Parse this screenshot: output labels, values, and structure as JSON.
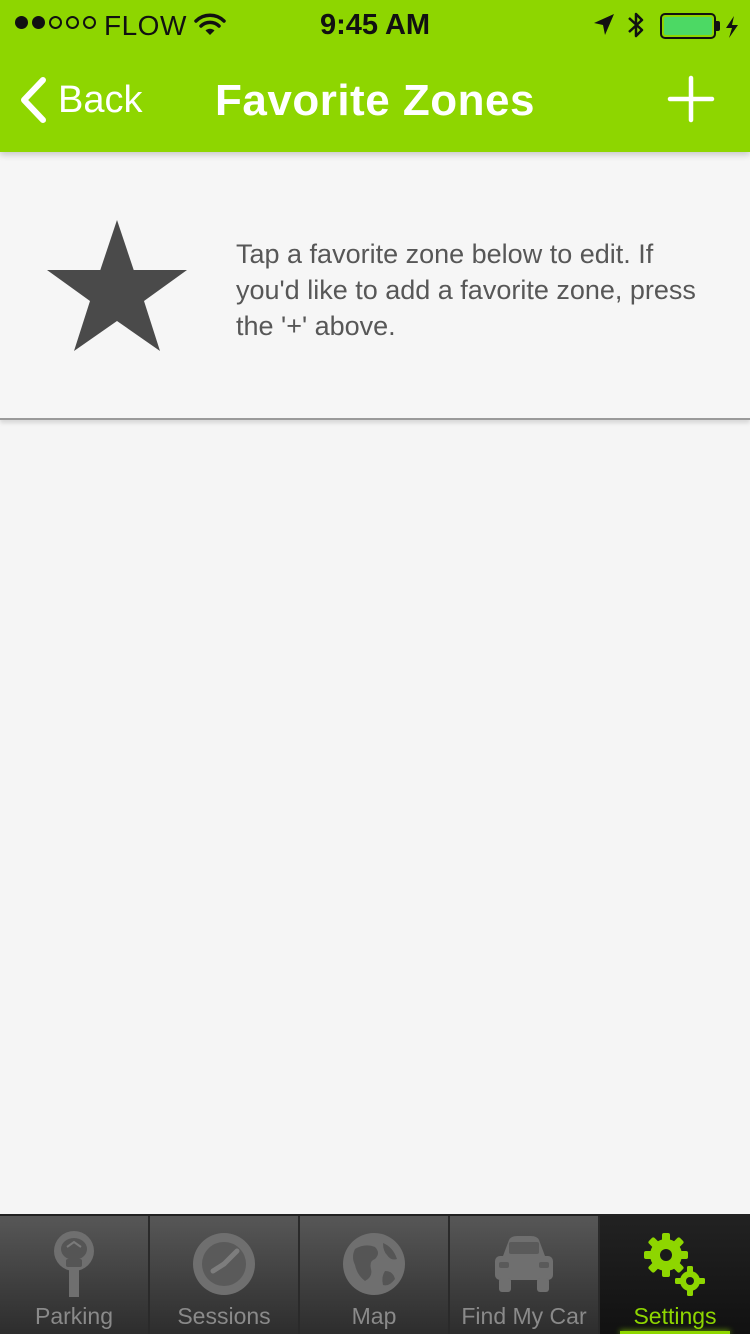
{
  "status_bar": {
    "carrier": "FLOW",
    "time": "9:45 AM",
    "signal_strength": 2,
    "signal_max": 5,
    "battery_level": 1.0
  },
  "nav": {
    "back_label": "Back",
    "title": "Favorite Zones",
    "add_icon": "plus-icon"
  },
  "info": {
    "icon": "star-icon",
    "text": "Tap a favorite zone below to edit. If you'd like to add a favorite zone, press the '+' above."
  },
  "tabs": [
    {
      "label": "Parking",
      "icon": "parking-meter-icon",
      "active": false
    },
    {
      "label": "Sessions",
      "icon": "clock-icon",
      "active": false
    },
    {
      "label": "Map",
      "icon": "globe-icon",
      "active": false
    },
    {
      "label": "Find My Car",
      "icon": "car-icon",
      "active": false
    },
    {
      "label": "Settings",
      "icon": "gears-icon",
      "active": true
    }
  ],
  "colors": {
    "accent": "#8ed600",
    "background": "#f5f5f5",
    "text_muted": "#575757",
    "icon_dark": "#4a4a4a",
    "tab_inactive": "#8a8a8a"
  }
}
